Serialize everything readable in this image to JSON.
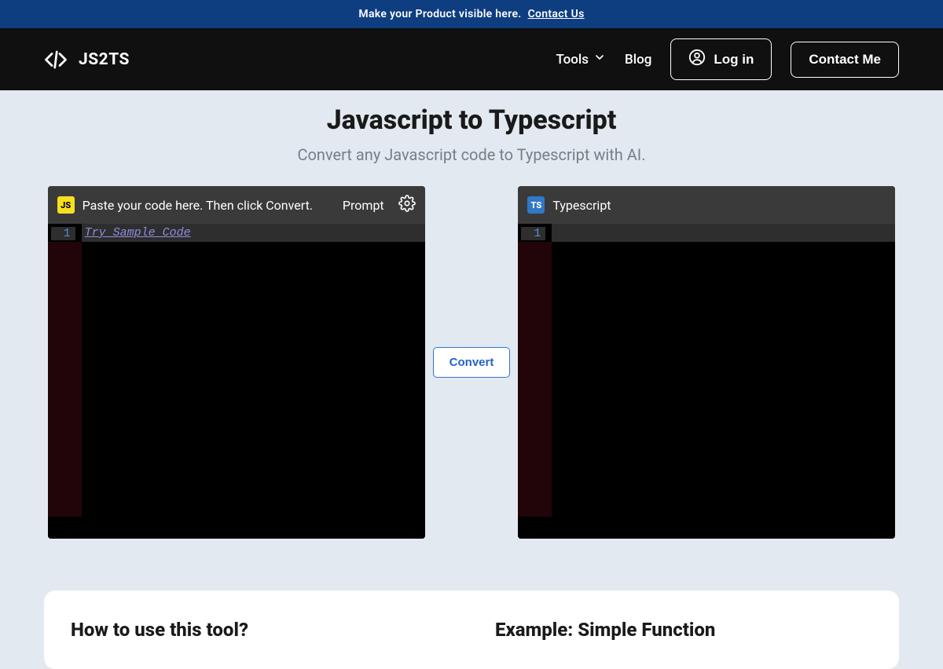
{
  "banner": {
    "text": "Make your Product visible here.",
    "link_label": "Contact Us"
  },
  "brand": {
    "name": "JS2TS"
  },
  "nav": {
    "tools": "Tools",
    "blog": "Blog",
    "login": "Log in",
    "contact": "Contact Me"
  },
  "hero": {
    "title": "Javascript to Typescript",
    "subtitle": "Convert any Javascript code to Typescript with AI."
  },
  "editor_left": {
    "badge": "JS",
    "label": "Paste your code here. Then click Convert.",
    "prompt": "Prompt",
    "line_no": "1",
    "sample_link": "Try Sample Code"
  },
  "editor_right": {
    "badge": "TS",
    "label": "Typescript",
    "line_no": "1"
  },
  "convert": {
    "label": "Convert"
  },
  "info": {
    "how_to_title": "How to use this tool?",
    "example_title": "Example: Simple Function"
  }
}
